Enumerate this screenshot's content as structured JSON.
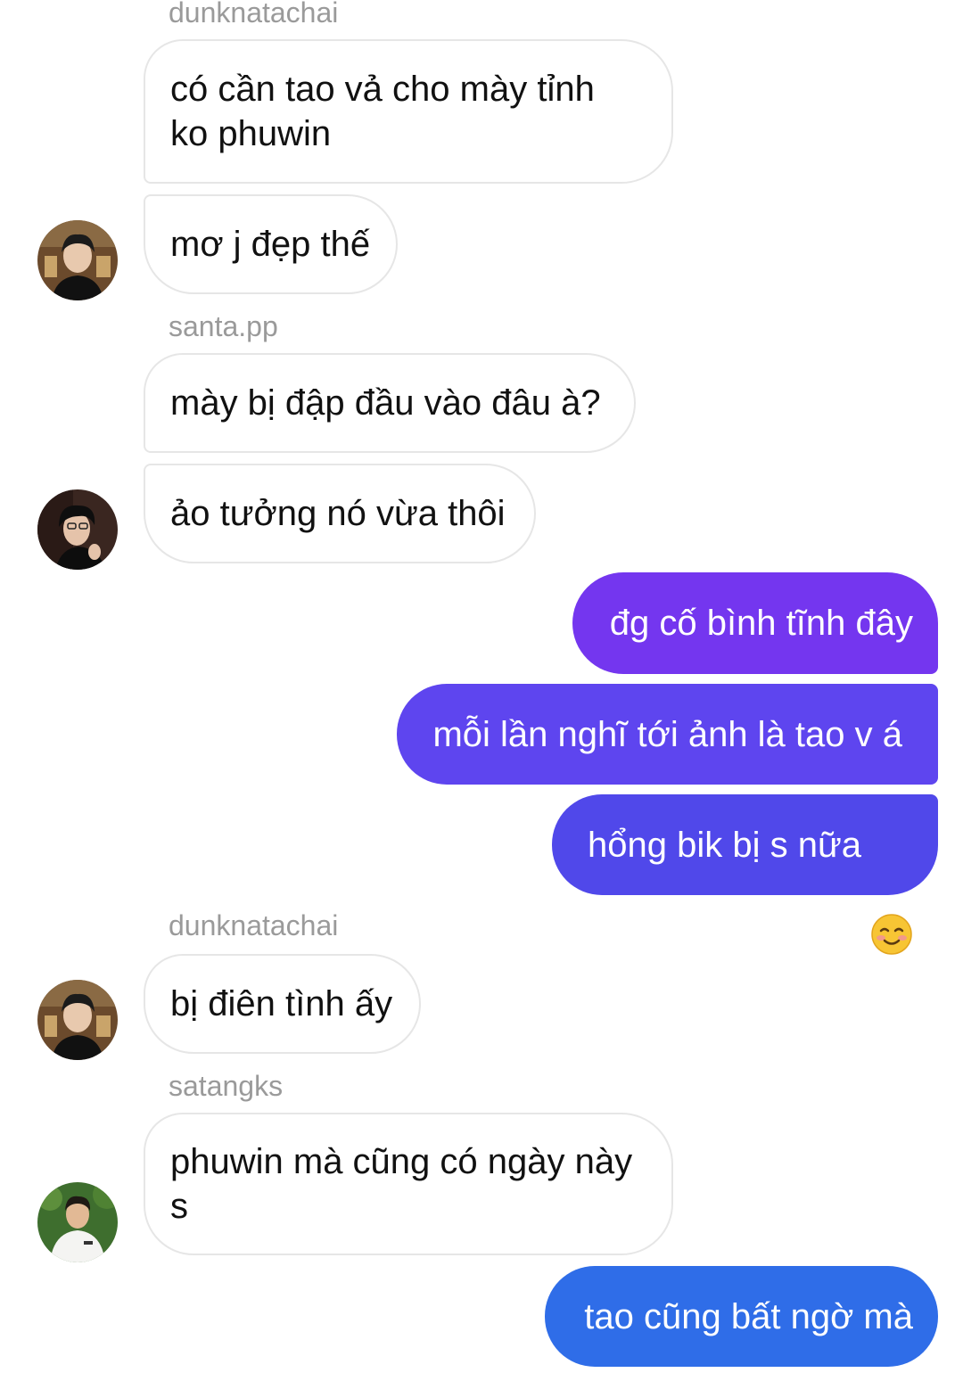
{
  "messages": [
    {
      "type": "sender",
      "text": "dunknatachai"
    },
    {
      "type": "incoming",
      "text": "có cần tao vả cho mày tỉnh\nko phuwin"
    },
    {
      "type": "incoming",
      "text": "mơ j đẹp thế"
    },
    {
      "type": "sender",
      "text": "santa.pp"
    },
    {
      "type": "incoming",
      "text": "mày bị đập đầu vào đâu à?"
    },
    {
      "type": "incoming",
      "text": "ảo tưởng nó vừa thôi"
    },
    {
      "type": "outgoing",
      "text": "đg cố bình tĩnh đây"
    },
    {
      "type": "outgoing",
      "text": "mỗi lần nghĩ tới ảnh là tao v á"
    },
    {
      "type": "outgoing",
      "text": "hổng bik bị s nữa",
      "emoji": "smiling-face-emoji"
    },
    {
      "type": "sender",
      "text": "dunknatachai"
    },
    {
      "type": "incoming",
      "text": "bị điên tình ấy"
    },
    {
      "type": "sender",
      "text": "satangks"
    },
    {
      "type": "incoming",
      "text": "phuwin mà cũng có ngày này\ns"
    },
    {
      "type": "outgoing",
      "text": "tao cũng bất ngờ mà"
    }
  ],
  "avatars": [
    {
      "user": "dunknatachai",
      "icon": "dunknatachai-avatar"
    },
    {
      "user": "santa.pp",
      "icon": "santa-avatar"
    },
    {
      "user": "dunknatachai",
      "icon": "dunknatachai-avatar"
    },
    {
      "user": "satangks",
      "icon": "satangks-avatar"
    }
  ],
  "colors": {
    "incoming_bg": "#ffffff",
    "incoming_border": "#e6e6e6",
    "outgoing_purple_top": "#7436ef",
    "outgoing_purple_mid": "#5e45ef",
    "outgoing_indigo": "#5048ea",
    "outgoing_blue": "#2f6de8",
    "sender_text": "#9a9a9a"
  }
}
